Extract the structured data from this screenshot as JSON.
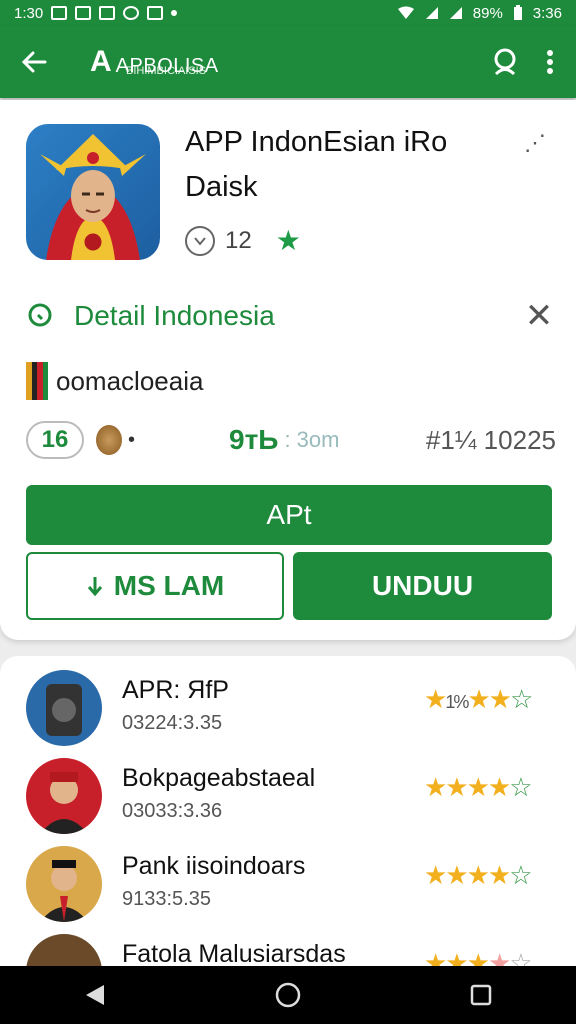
{
  "status_bar": {
    "left": "1:30",
    "battery": "89%",
    "time": "3:36"
  },
  "app_bar": {
    "brand_letter": "A",
    "brand_text": "APBOLISA",
    "brand_sup": "BIHIMBICIAISIS"
  },
  "app": {
    "title": "APP IndonEsian iRo Daisk",
    "meta_count": "12",
    "detail_label": "Detail Indonesia",
    "subtitle": "oomacloeaia",
    "stat_pill": "16",
    "size": "9тЬ",
    "size_sub": ": 3om",
    "rank": "#1¼ 10225",
    "btn_main": "APt",
    "btn_outline": "MS LAM",
    "btn_unduh": "UNDUU"
  },
  "reviews": [
    {
      "name": "APR: ЯfP",
      "sub": "03224:3.35",
      "stars_text": "1%"
    },
    {
      "name": "Bokpageabstaeal",
      "sub": "03033:3.36",
      "stars_text": ""
    },
    {
      "name": "Pank iisoindoars",
      "sub": "9133:5.35",
      "stars_text": ""
    },
    {
      "name": "Fatola Malusiarsdas",
      "sub": "",
      "stars_text": ""
    }
  ],
  "colors": {
    "primary": "#1e8a3c",
    "star": "#f2b01e"
  }
}
